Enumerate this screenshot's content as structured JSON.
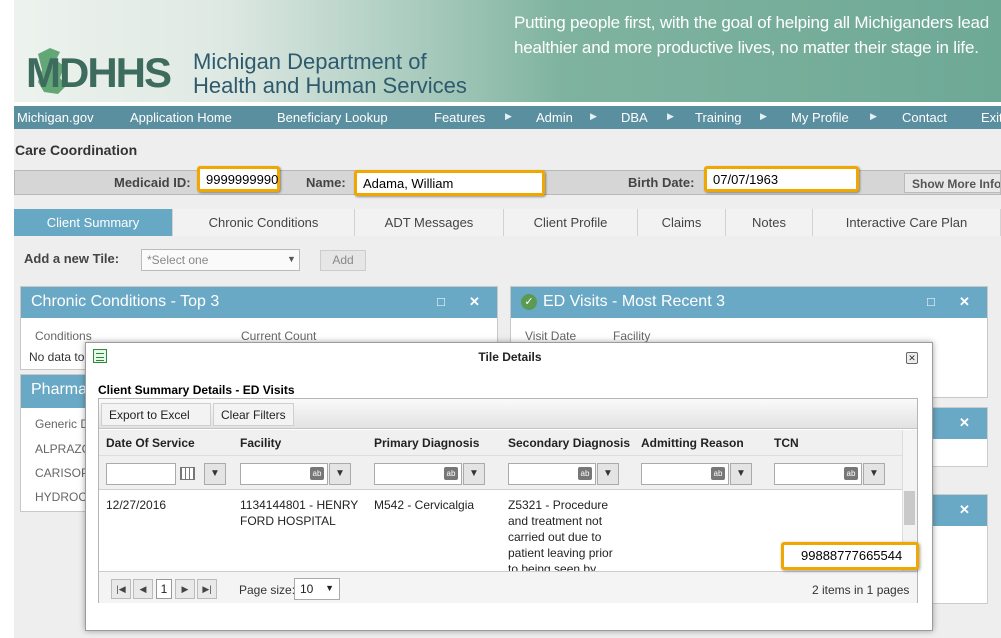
{
  "header": {
    "tagline_line1": "Putting people first, with the goal of helping all Michiganders lead",
    "tagline_line2": "healthier and more productive lives, no matter their stage in life.",
    "logo_short": "MDHHS",
    "logo_line1": "Michigan Department of",
    "logo_line2": "Health and Human Services"
  },
  "nav": {
    "items": [
      "Michigan.gov",
      "Application Home",
      "Beneficiary Lookup",
      "Features",
      "Admin",
      "DBA",
      "Training",
      "My Profile",
      "Contact",
      "Exit"
    ]
  },
  "page": {
    "title": "Care Coordination"
  },
  "patient": {
    "medicaid_label": "Medicaid ID:",
    "medicaid_id": "9999999990",
    "name_label": "Name:",
    "name": "Adama, William",
    "birth_label": "Birth Date:",
    "birth_date": "07/07/1963",
    "show_more": "Show More Info"
  },
  "tabs": [
    "Client Summary",
    "Chronic Conditions",
    "ADT Messages",
    "Client Profile",
    "Claims",
    "Notes",
    "Interactive Care Plan"
  ],
  "add_tile": {
    "label": "Add a new Tile:",
    "select_value": "*Select one",
    "button": "Add"
  },
  "tiles": {
    "chronic": {
      "title": "Chronic Conditions - Top 3",
      "col1": "Conditions",
      "col2": "Current Count",
      "empty": "No data to"
    },
    "pharmacy": {
      "title": "Pharma",
      "col1": "Generic D",
      "rows": [
        "ALPRAZO",
        "CARISOP",
        "HYDROC"
      ]
    },
    "ed": {
      "title": "ED Visits - Most Recent 3",
      "col1": "Visit Date",
      "col2": "Facility"
    },
    "restore_icon": "□",
    "close_icon": "✕"
  },
  "modal": {
    "title": "Tile Details",
    "caption": "Client Summary Details - ED Visits",
    "toolbar": {
      "export": "Export to Excel",
      "clear": "Clear Filters"
    },
    "columns": [
      "Date Of Service",
      "Facility",
      "Primary Diagnosis",
      "Secondary Diagnosis",
      "Admitting Reason",
      "TCN"
    ],
    "rows": [
      {
        "date": "12/27/2016",
        "facility_l1": "1134144801 - HENRY",
        "facility_l2": "FORD HOSPITAL",
        "primary": "M542 - Cervicalgia",
        "secondary_l1": "Z5321 - Procedure",
        "secondary_l2": "and treatment not",
        "secondary_l3": "carried out due to",
        "secondary_l4": "patient leaving prior",
        "secondary_l5": "to being seen by",
        "admitting": "",
        "tcn": "99888777665544"
      }
    ],
    "pager": {
      "current_page": "1",
      "size_label": "Page size:",
      "size": "10",
      "info": "2 items in 1 pages"
    }
  }
}
